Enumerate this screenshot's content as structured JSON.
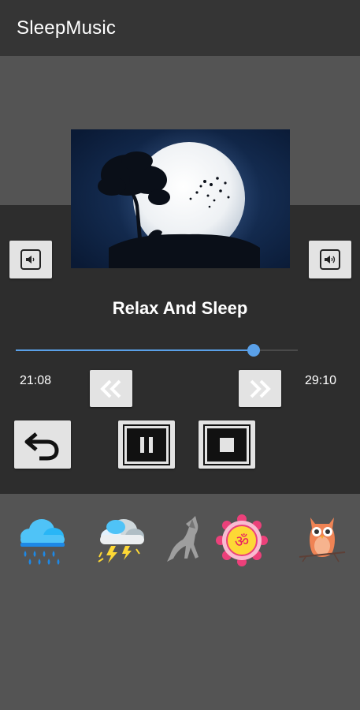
{
  "app": {
    "title": "SleepMusic"
  },
  "player": {
    "track_title": "Relax And Sleep",
    "elapsed": "21:08",
    "total": "29:10",
    "progress": 0.843
  },
  "icons": {
    "volume_left": "volume-icon",
    "volume_right": "volume-icon",
    "rewind": "double-chevron-left-icon",
    "forward": "double-chevron-right-icon",
    "back": "undo-arrow-icon",
    "pause": "pause-icon",
    "stop": "stop-icon"
  },
  "sounds": [
    {
      "icon": "rain-cloud-icon"
    },
    {
      "icon": "thunderstorm-icon"
    },
    {
      "icon": "howling-wolf-icon"
    },
    {
      "icon": "om-mandala-icon"
    },
    {
      "icon": "owl-icon"
    }
  ],
  "colors": {
    "appbar": "#353535",
    "background": "#545454",
    "panel": "#2d2d2d",
    "accent": "#5aa0e8",
    "button": "#e3e3e3"
  }
}
